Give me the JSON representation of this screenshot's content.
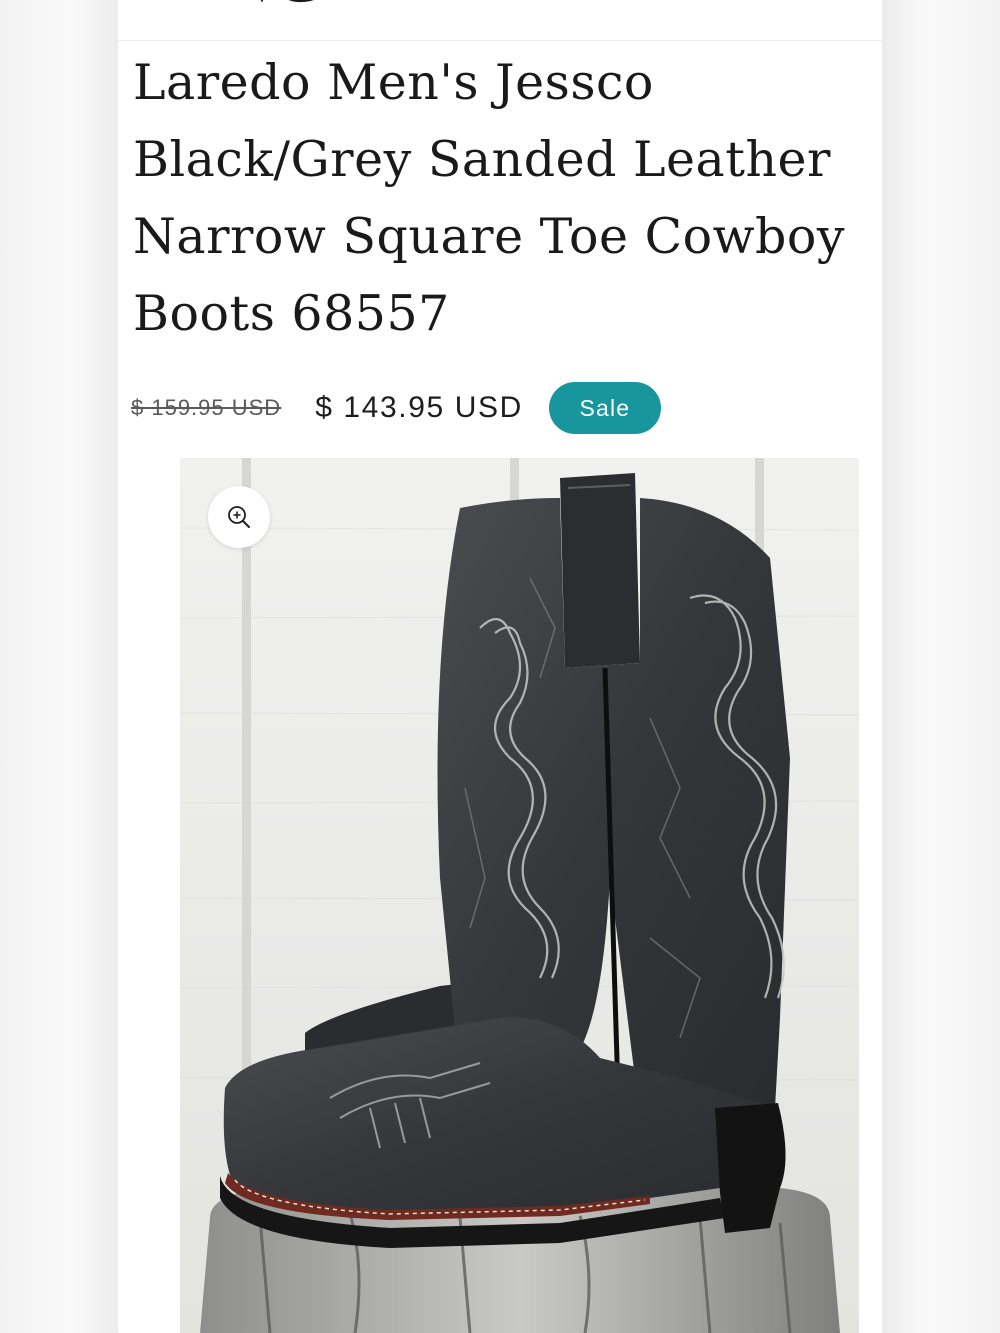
{
  "product": {
    "title": "Laredo Men's Jessco Black/Grey Sanded Leather Narrow Square Toe Cowboy Boots 68557",
    "price_regular": "$ 159.95 USD",
    "price_sale": "$ 143.95 USD",
    "badge": "Sale"
  },
  "media": {
    "image_subject": "product-photo",
    "zoom_icon": "zoom-in-icon"
  },
  "colors": {
    "badge_background": "#17969e",
    "text": "#1a1a1a",
    "strike_price": "#5a5a5a",
    "boot_leather": "#3b3d40",
    "boot_sole": "#161616",
    "welt": "#7a2e24"
  }
}
